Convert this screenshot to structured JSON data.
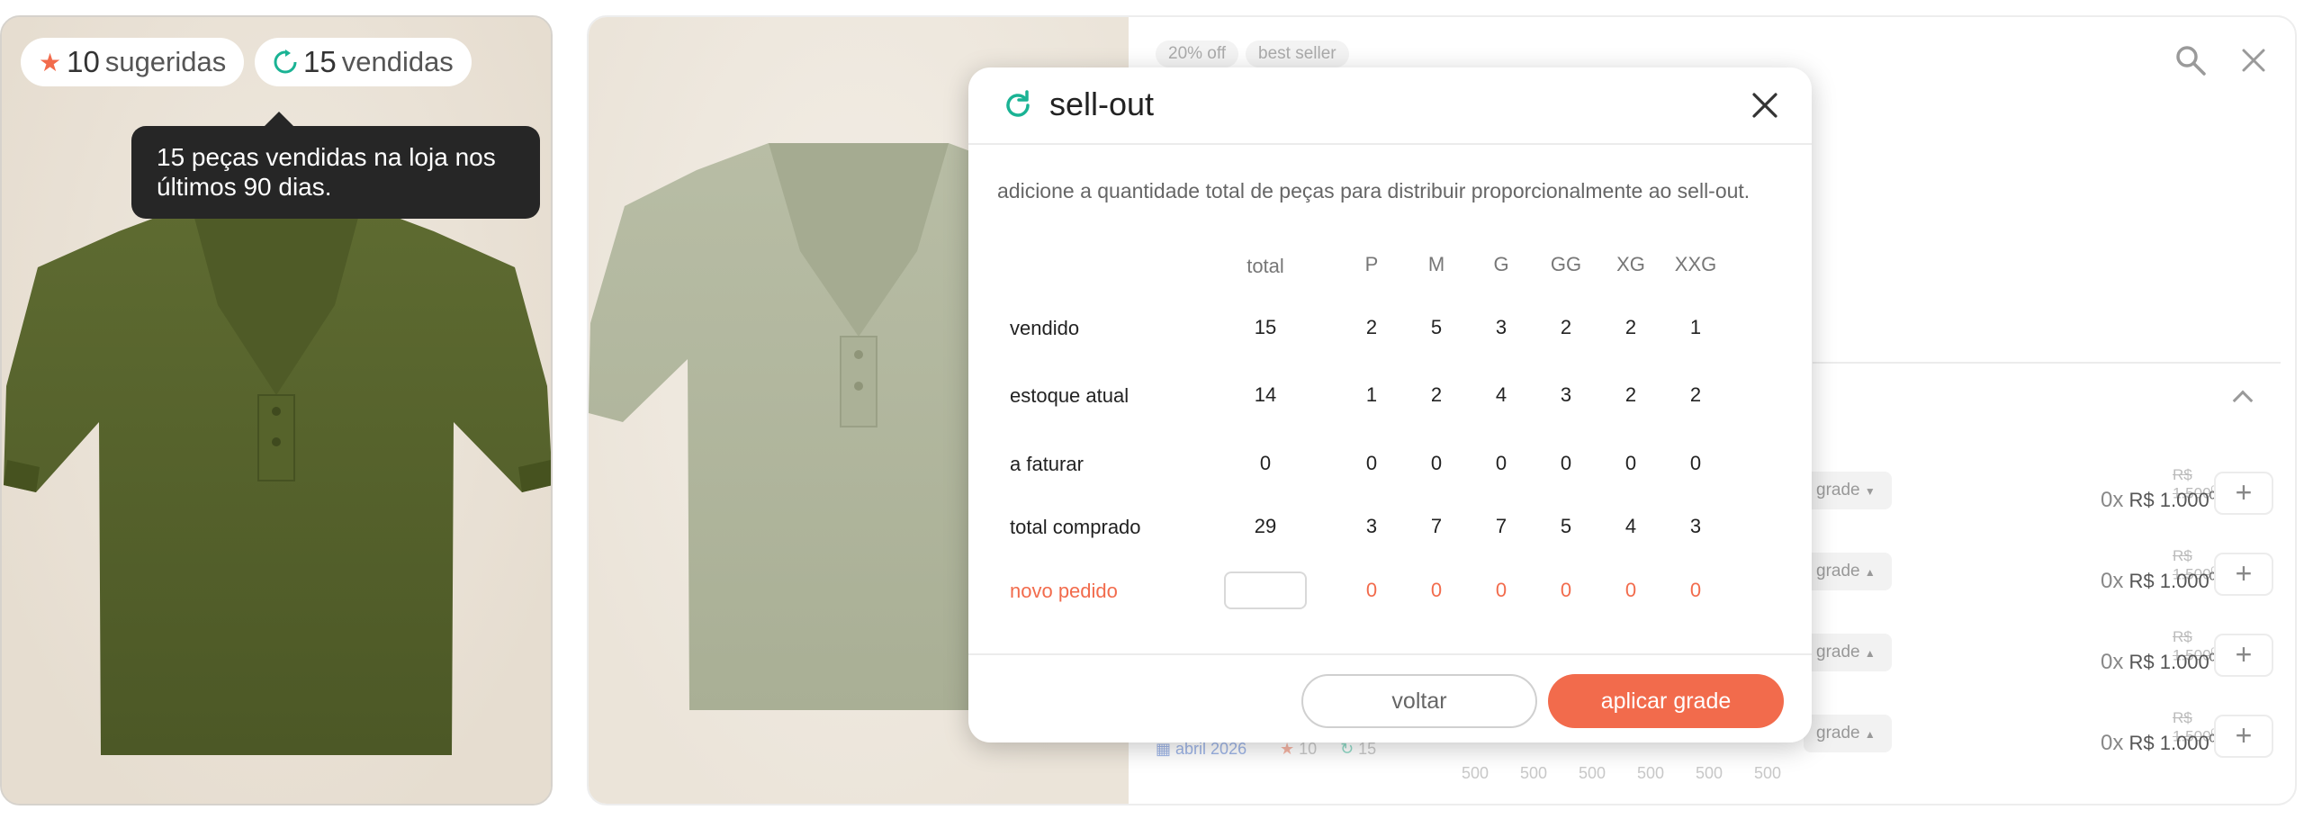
{
  "left_card": {
    "suggested_count": "10",
    "suggested_label": "sugeridas",
    "sold_count": "15",
    "sold_label": "vendidas",
    "tooltip": "15 peças vendidas na loja nos últimos 90 dias."
  },
  "panel": {
    "chips": [
      "20% off",
      "best seller"
    ],
    "rows": [
      {
        "grade": "grade",
        "old_price": "R$ 1.500",
        "old_cents": "00",
        "qty": "0x",
        "price": "R$ 1.000",
        "cents": "00"
      },
      {
        "grade": "grade",
        "old_price": "R$ 1.500",
        "old_cents": "00",
        "qty": "0x",
        "price": "R$ 1.000",
        "cents": "00"
      },
      {
        "grade": "grade",
        "old_price": "R$ 1.500",
        "old_cents": "00",
        "qty": "0x",
        "price": "R$ 1.000",
        "cents": "00"
      },
      {
        "grade": "grade",
        "old_price": "R$ 1.500",
        "old_cents": "00",
        "qty": "0x",
        "price": "R$ 1.000",
        "cents": "00"
      }
    ],
    "behind_text": {
      "date": "abril 2026",
      "suggested": "10",
      "sold": "15",
      "sizes": [
        "500",
        "500",
        "500",
        "500",
        "500",
        "500"
      ]
    },
    "plus_label": "+"
  },
  "modal": {
    "title": "sell-out",
    "description": "adicione a quantidade total de peças para distribuir proporcionalmente ao sell-out.",
    "columns": [
      "total",
      "P",
      "M",
      "G",
      "GG",
      "XG",
      "XXG"
    ],
    "rows": [
      {
        "label": "vendido",
        "values": [
          "15",
          "2",
          "5",
          "3",
          "2",
          "2",
          "1"
        ]
      },
      {
        "label": "estoque atual",
        "values": [
          "14",
          "1",
          "2",
          "4",
          "3",
          "2",
          "2"
        ]
      },
      {
        "label": "a faturar",
        "values": [
          "0",
          "0",
          "0",
          "0",
          "0",
          "0",
          "0"
        ]
      },
      {
        "label": "total comprado",
        "values": [
          "29",
          "3",
          "7",
          "7",
          "5",
          "4",
          "3"
        ]
      }
    ],
    "new_order": {
      "label": "novo pedido",
      "values": [
        "0",
        "0",
        "0",
        "0",
        "0",
        "0"
      ]
    },
    "back_label": "voltar",
    "apply_label": "aplicar grade"
  },
  "colors": {
    "accent": "#f26b4c",
    "sold_icon": "#1ab394",
    "star": "#f26b4c",
    "shirt_dark": "#58652d",
    "shirt_light": "#b3b8a0"
  }
}
